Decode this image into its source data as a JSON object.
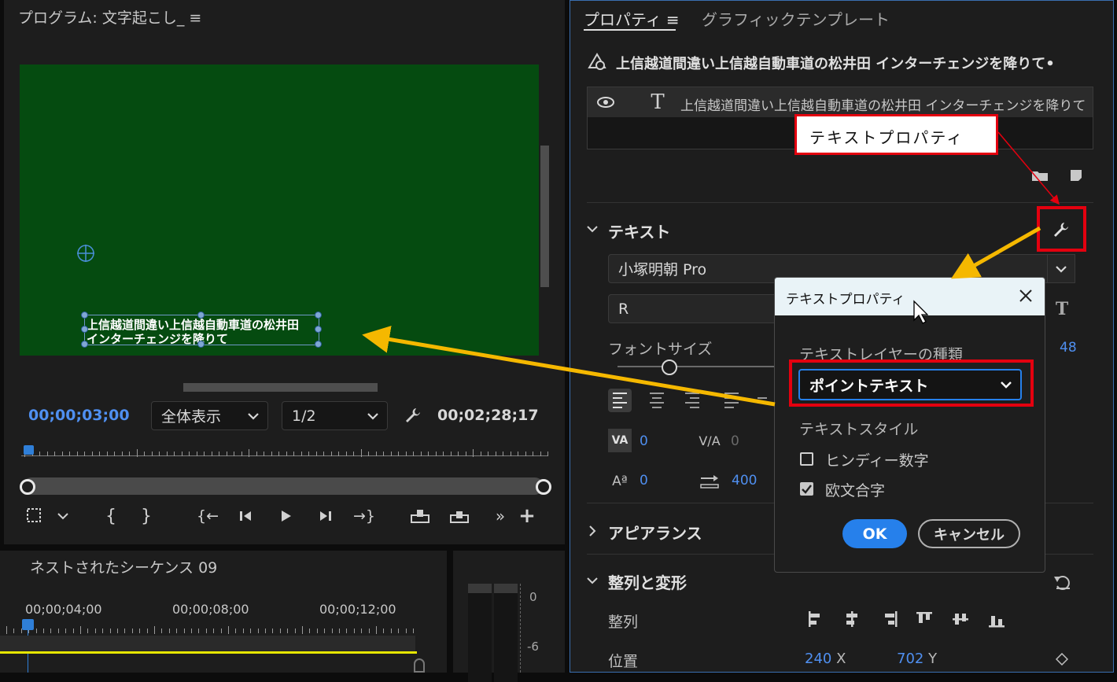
{
  "program_monitor": {
    "title": "プログラム: 文字起こし_",
    "caption_line1": "上信越道間違い上信越自動車道の松井田",
    "caption_line2": "インターチェンジを降りて",
    "current_time": "00;00;03;00",
    "zoom_value": "全体表示",
    "resolution_value": "1/2",
    "duration": "00;02;28;17"
  },
  "timeline": {
    "title": "ネストされたシーケンス 09",
    "ruler_labels": [
      "00;00;04;00",
      "00;00;08;00",
      "00;00;12;00"
    ],
    "meter_labels": [
      "0",
      "-6"
    ]
  },
  "properties": {
    "tab_properties": "プロパティ",
    "tab_graphics": "グラフィックテンプレート",
    "clip_name": "上信越道間違い上信越自動車道の松井田 インターチェンジを降りて•",
    "layer_name": "上信越道間違い上信越自動車道の松井田 インターチェンジを降りて",
    "section_text": "テキスト",
    "font_family": "小塚明朝 Pro",
    "font_style": "R",
    "font_size_label": "フォントサイズ",
    "font_size_value": "48",
    "kerning_value": "0",
    "tracking_value": "0",
    "baseline_value": "0",
    "tab_width_value": "400",
    "section_appearance": "アピアランス",
    "section_align": "整列と変形",
    "align_label": "整列",
    "position_label": "位置",
    "position_x": "240",
    "position_x_unit": "X",
    "position_y": "702",
    "position_y_unit": "Y"
  },
  "callout": {
    "label": "テキストプロパティ"
  },
  "dialog": {
    "title": "テキストプロパティ",
    "layer_type_label": "テキストレイヤーの種類",
    "layer_type_value": "ポイントテキスト",
    "text_style_label": "テキストスタイル",
    "option_hindi_digits": "ヒンディー数字",
    "option_hindi_checked": false,
    "option_ligatures": "欧文合字",
    "option_ligatures_checked": true,
    "ok_label": "OK",
    "cancel_label": "キャンセル"
  },
  "colors": {
    "accent_blue": "#2680eb",
    "timecode_blue": "#4f8ff0",
    "highlight_red": "#e4000f",
    "arrow_yellow": "#f5b800",
    "video_green": "#054b10",
    "timeline_yellow": "#e6e600"
  }
}
